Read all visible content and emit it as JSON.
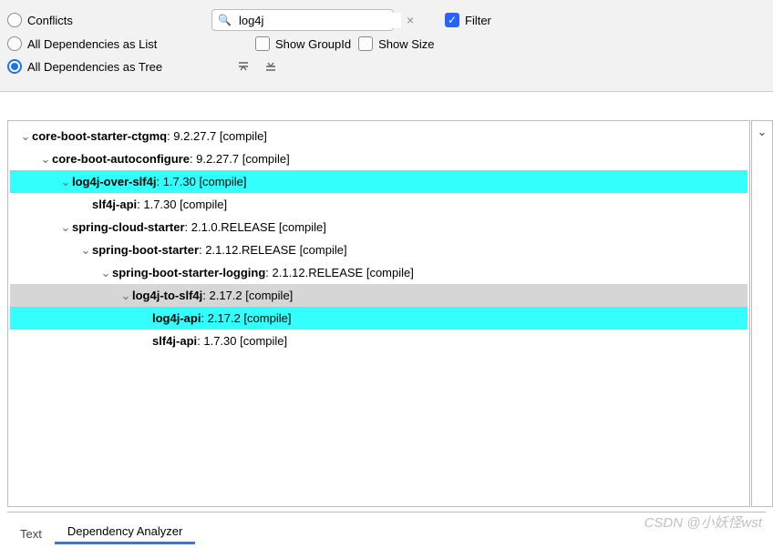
{
  "toolbar": {
    "radios": {
      "conflicts": "Conflicts",
      "as_list": "All Dependencies as List",
      "as_tree": "All Dependencies as Tree"
    },
    "search_value": "log4j",
    "filter_label": "Filter",
    "show_groupid_label": "Show GroupId",
    "show_size_label": "Show Size"
  },
  "tree": [
    {
      "indent": 0,
      "expand": "v",
      "name": "core-boot-starter-ctgmq",
      "suffix": " : 9.2.27.7 [compile]",
      "hl": ""
    },
    {
      "indent": 1,
      "expand": "v",
      "name": "core-boot-autoconfigure",
      "suffix": " : 9.2.27.7 [compile]",
      "hl": ""
    },
    {
      "indent": 2,
      "expand": "v",
      "name": "log4j-over-slf4j",
      "suffix": " : 1.7.30 [compile]",
      "hl": "cyan"
    },
    {
      "indent": 3,
      "expand": "",
      "name": "slf4j-api",
      "suffix": " : 1.7.30 [compile]",
      "hl": ""
    },
    {
      "indent": 2,
      "expand": "v",
      "name": "spring-cloud-starter",
      "suffix": " : 2.1.0.RELEASE [compile]",
      "hl": ""
    },
    {
      "indent": 3,
      "expand": "v",
      "name": "spring-boot-starter",
      "suffix": " : 2.1.12.RELEASE [compile]",
      "hl": ""
    },
    {
      "indent": 4,
      "expand": "v",
      "name": "spring-boot-starter-logging",
      "suffix": " : 2.1.12.RELEASE [compile]",
      "hl": ""
    },
    {
      "indent": 5,
      "expand": "v",
      "name": "log4j-to-slf4j",
      "suffix": " : 2.17.2 [compile]",
      "hl": "gray"
    },
    {
      "indent": 6,
      "expand": "",
      "name": "log4j-api",
      "suffix": " : 2.17.2 [compile]",
      "hl": "cyan"
    },
    {
      "indent": 6,
      "expand": "",
      "name": "slf4j-api",
      "suffix": " : 1.7.30 [compile]",
      "hl": ""
    }
  ],
  "side_strip": "⌄",
  "tabs": {
    "text": "Text",
    "analyzer": "Dependency Analyzer"
  },
  "watermark": "CSDN @小妖怪wst"
}
